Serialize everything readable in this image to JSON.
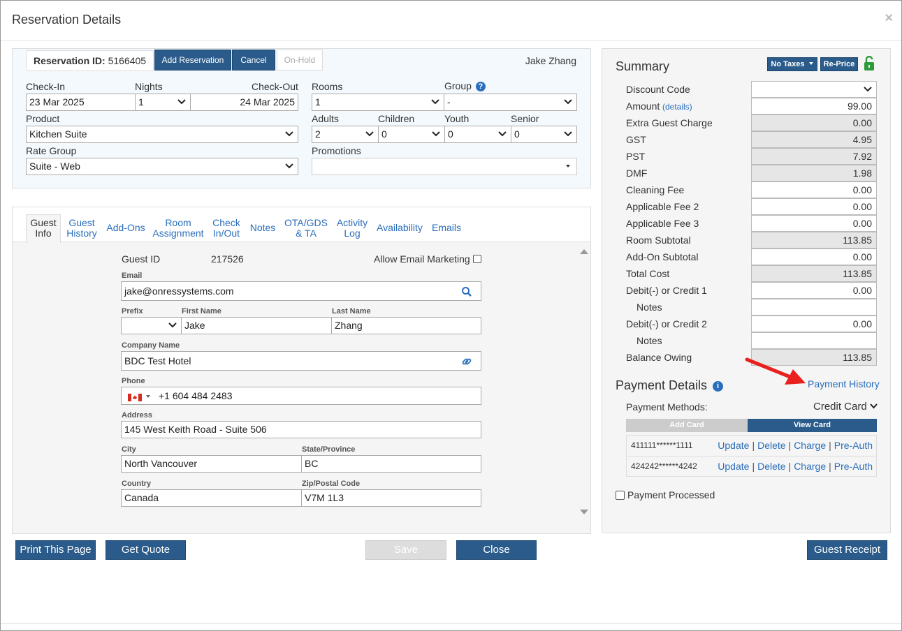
{
  "modal": {
    "title": "Reservation Details",
    "close": "×"
  },
  "reservation": {
    "id_label": "Reservation ID:",
    "id_value": "5166405",
    "add_button": "Add Reservation",
    "cancel_button": "Cancel",
    "onhold_button": "On-Hold",
    "guest_name": "Jake Zhang"
  },
  "booking": {
    "checkin_label": "Check-In",
    "checkin_value": "23 Mar 2025",
    "nights_label": "Nights",
    "nights_value": "1",
    "checkout_label": "Check-Out",
    "checkout_value": "24 Mar 2025",
    "rooms_label": "Rooms",
    "rooms_value": "1",
    "group_label": "Group",
    "group_value": "-",
    "product_label": "Product",
    "product_value": "Kitchen Suite",
    "adults_label": "Adults",
    "adults_value": "2",
    "children_label": "Children",
    "children_value": "0",
    "youth_label": "Youth",
    "youth_value": "0",
    "senior_label": "Senior",
    "senior_value": "0",
    "rategroup_label": "Rate Group",
    "rategroup_value": "Suite - Web",
    "promotions_label": "Promotions",
    "promotions_value": ""
  },
  "tabs": [
    {
      "l1": "Guest",
      "l2": "Info"
    },
    {
      "l1": "Guest",
      "l2": "History"
    },
    {
      "l1": "Add-Ons",
      "l2": ""
    },
    {
      "l1": "Room",
      "l2": "Assignment"
    },
    {
      "l1": "Check",
      "l2": "In/Out"
    },
    {
      "l1": "Notes",
      "l2": ""
    },
    {
      "l1": "OTA/GDS",
      "l2": "& TA"
    },
    {
      "l1": "Activity",
      "l2": "Log"
    },
    {
      "l1": "Availability",
      "l2": ""
    },
    {
      "l1": "Emails",
      "l2": ""
    }
  ],
  "guest": {
    "id_label": "Guest ID",
    "id_value": "217526",
    "email_marketing_label": "Allow Email Marketing",
    "email_label": "Email",
    "email_value": "jake@onressystems.com",
    "prefix_label": "Prefix",
    "prefix_value": "",
    "first_label": "First Name",
    "first_value": "Jake",
    "last_label": "Last Name",
    "last_value": "Zhang",
    "company_label": "Company Name",
    "company_value": "BDC Test Hotel",
    "phone_label": "Phone",
    "phone_value": "+1 604 484 2483",
    "address_label": "Address",
    "address_value": "145 West Keith Road - Suite 506",
    "city_label": "City",
    "city_value": "North Vancouver",
    "state_label": "State/Province",
    "state_value": "BC",
    "country_label": "Country",
    "country_value": "Canada",
    "zip_label": "Zip/Postal Code",
    "zip_value": "V7M 1L3"
  },
  "summary": {
    "title": "Summary",
    "no_taxes": "No Taxes",
    "reprice": "Re-Price",
    "rows": [
      {
        "label": "Discount Code",
        "value": "",
        "style": "select"
      },
      {
        "label": "Amount",
        "value": "99.00",
        "style": "white",
        "sub": "(details)"
      },
      {
        "label": "Extra Guest Charge",
        "value": "0.00",
        "style": "gray"
      },
      {
        "label": "GST",
        "value": "4.95",
        "style": "gray"
      },
      {
        "label": "PST",
        "value": "7.92",
        "style": "gray"
      },
      {
        "label": "DMF",
        "value": "1.98",
        "style": "gray"
      },
      {
        "label": "Cleaning Fee",
        "value": "0.00",
        "style": "white"
      },
      {
        "label": "Applicable Fee 2",
        "value": "0.00",
        "style": "white"
      },
      {
        "label": "Applicable Fee 3",
        "value": "0.00",
        "style": "white"
      },
      {
        "label": "Room Subtotal",
        "value": "113.85",
        "style": "gray"
      },
      {
        "label": "Add-On Subtotal",
        "value": "0.00",
        "style": "white"
      },
      {
        "label": "Total Cost",
        "value": "113.85",
        "style": "gray"
      },
      {
        "label": "Debit(-) or Credit 1",
        "value": "0.00",
        "style": "white"
      },
      {
        "label": "Notes",
        "value": "",
        "style": "white",
        "indent": true
      },
      {
        "label": "Debit(-) or Credit 2",
        "value": "0.00",
        "style": "white"
      },
      {
        "label": "Notes",
        "value": "",
        "style": "white",
        "indent": true
      },
      {
        "label": "Balance Owing",
        "value": "113.85",
        "style": "gray"
      }
    ]
  },
  "payment": {
    "title": "Payment Details",
    "history_link": "Payment History",
    "methods_label": "Payment Methods:",
    "methods_value": "Credit Card",
    "add_card": "Add Card",
    "view_card": "View Card",
    "cards": [
      {
        "number": "411111******1111"
      },
      {
        "number": "424242******4242"
      }
    ],
    "actions": {
      "update": "Update",
      "delete": "Delete",
      "charge": "Charge",
      "preauth": "Pre-Auth",
      "sep": "|"
    },
    "processed_label": "Payment Processed"
  },
  "footer": {
    "print": "Print This Page",
    "quote": "Get Quote",
    "save": "Save",
    "close": "Close",
    "receipt": "Guest Receipt"
  },
  "colors": {
    "primary": "#2a5b8a",
    "link": "#2a6ebb",
    "arrow": "#e8201e",
    "lock": "#2e9a3a"
  }
}
